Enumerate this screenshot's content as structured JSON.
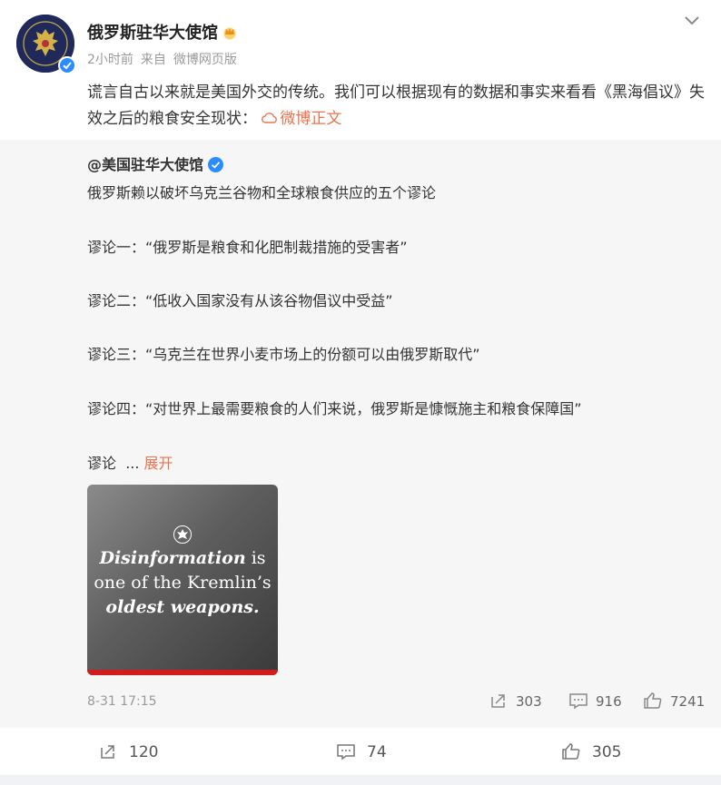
{
  "post": {
    "author": "俄罗斯驻华大使馆",
    "time": "2小时前",
    "source_prefix": "来自",
    "source": "微博网页版",
    "text": "谎言自古以来就是美国外交的传统。我们可以根据现有的数据和事实来看看《黑海倡议》失效之后的粮食安全现状：",
    "link_text": "微博正文",
    "icons": {
      "avatar": "embassy-crest",
      "badge": "verified-badge",
      "crown": "crown-icon",
      "menu": "chevron-down-icon"
    },
    "accent_color": "#eb7350"
  },
  "repost": {
    "author": "@美国驻华大使馆",
    "lines": [
      "俄罗斯赖以破坏乌克兰谷物和全球粮食供应的五个谬论",
      "谬论一：“俄罗斯是粮食和化肥制裁措施的受害者”",
      "谬论二：“低收入国家没有从该谷物倡议中受益”",
      "谬论三：“乌克兰在世界小麦市场上的份额可以由俄罗斯取代”",
      "谬论四：“对世界上最需要粮食的人们来说，俄罗斯是慷慨施主和粮食保障国”"
    ],
    "truncated_prefix": "谬论",
    "ellipsis": "...",
    "expand_label": "展开",
    "image_text": {
      "line1_em": "Disinformation",
      "line1_rest": " is",
      "line2": "one of the Kremlin’s",
      "line3": "oldest weapons."
    },
    "date": "8-31 17:15",
    "shares": "303",
    "comments": "916",
    "likes": "7241"
  },
  "footer": {
    "shares": "120",
    "comments": "74",
    "likes": "305"
  }
}
